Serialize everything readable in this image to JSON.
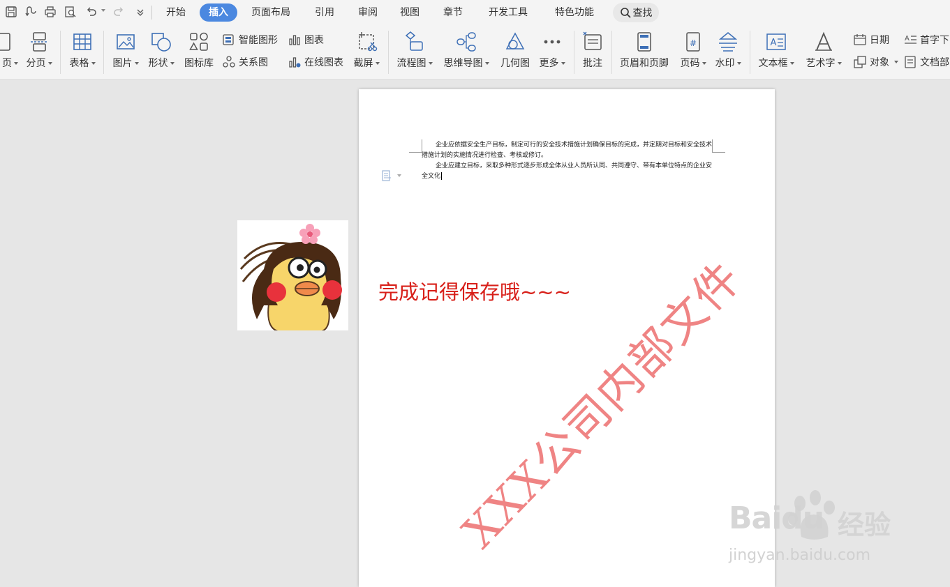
{
  "menu": {
    "tabs": [
      {
        "label": "开始"
      },
      {
        "label": "插入",
        "active": true
      },
      {
        "label": "页面布局"
      },
      {
        "label": "引用"
      },
      {
        "label": "审阅"
      },
      {
        "label": "视图"
      },
      {
        "label": "章节"
      },
      {
        "label": "开发工具"
      },
      {
        "label": "特色功能"
      }
    ],
    "search_label": "查找"
  },
  "ribbon": {
    "page_partial": "页",
    "page_break": "分页",
    "table": "表格",
    "picture": "图片",
    "shape": "形状",
    "icon_library": "图标库",
    "smart_graphic": "智能图形",
    "chart": "图表",
    "relation_diagram": "关系图",
    "online_chart": "在线图表",
    "screenshot": "截屏",
    "flowchart": "流程图",
    "mind_map": "思维导图",
    "geometry": "几何图",
    "more": "更多",
    "comment": "批注",
    "header_footer": "页眉和页脚",
    "page_number": "页码",
    "watermark": "水印",
    "text_box": "文本框",
    "word_art": "艺术字",
    "date": "日期",
    "object": "对象",
    "drop_cap": "首字下",
    "doc_parts": "文档部"
  },
  "document": {
    "paragraph_1": "企业应依据安全生产目标，制定可行的安全技术措施计划确保目标的完成，并定期对目标和安全技术措施计划的实施情况进行检查、考核或修订。",
    "paragraph_2": "企业应建立目标，采取多种形式逐步形成全体从业人员所认同、共同遵守、带有本单位特点的企业安全文化",
    "save_note": "完成记得保存哦~~~",
    "watermark_text": "XXX公司内部文件"
  },
  "overlay": {
    "baidu_logo": "Baidu",
    "baidu_jingyan": "经验",
    "baidu_url": "jingyan.baidu.com"
  },
  "colors": {
    "accent": "#4b88e0",
    "icon_blue": "#3d6fb6",
    "note_red": "#d8201a",
    "watermark_red": "#ec6e6e"
  }
}
